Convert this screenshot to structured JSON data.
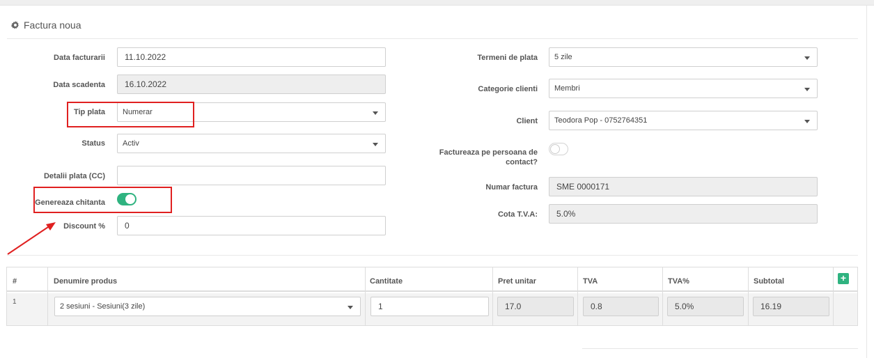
{
  "panel": {
    "title": "Factura noua",
    "icon": "gear-icon"
  },
  "left": {
    "invoice_date": {
      "label": "Data facturarii",
      "value": "11.10.2022"
    },
    "due_date": {
      "label": "Data scadenta",
      "value": "16.10.2022"
    },
    "payment_type": {
      "label": "Tip plata",
      "value": "Numerar"
    },
    "status": {
      "label": "Status",
      "value": "Activ"
    },
    "payment_details": {
      "label": "Detalii plata (CC)",
      "value": ""
    },
    "generate_receipt": {
      "label": "Genereaza chitanta",
      "on": true
    },
    "discount": {
      "label": "Discount %",
      "value": "0"
    }
  },
  "right": {
    "payment_terms": {
      "label": "Termeni de plata",
      "value": "5 zile"
    },
    "client_category": {
      "label": "Categorie clienti",
      "value": "Membri"
    },
    "client": {
      "label": "Client",
      "value": "Teodora Pop - 0752764351"
    },
    "invoice_contact_person": {
      "label_line1": "Factureaza pe persoana de",
      "label_line2": "contact?",
      "on": false
    },
    "invoice_number": {
      "label": "Numar factura",
      "value": "SME 0000171"
    },
    "vat_rate": {
      "label": "Cota T.V.A:",
      "value": "5.0%"
    }
  },
  "table": {
    "headers": {
      "index": "#",
      "product": "Denumire produs",
      "quantity": "Cantitate",
      "unit_price": "Pret unitar",
      "vat": "TVA",
      "vat_pct": "TVA%",
      "subtotal": "Subtotal"
    },
    "add_button_label": "+",
    "rows": [
      {
        "index": "1",
        "product": "2 sesiuni - Sesiuni(3 zile)",
        "quantity": "1",
        "unit_price": "17.0",
        "vat": "0.8",
        "vat_pct": "5.0%",
        "subtotal": "16.19"
      }
    ]
  },
  "colors": {
    "accent_green": "#2fb380",
    "highlight_red": "#e02020"
  }
}
